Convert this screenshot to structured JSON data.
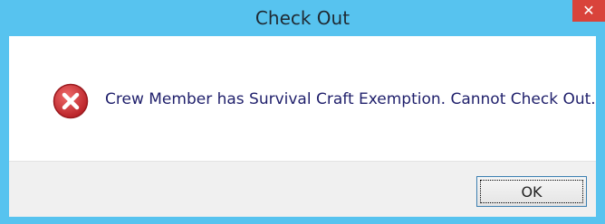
{
  "window": {
    "title": "Check Out",
    "close_glyph": "✕"
  },
  "message": {
    "icon": "error-x-circle-icon",
    "text": "Crew Member has Survival Craft Exemption. Cannot Check Out."
  },
  "buttons": {
    "ok_label": "OK"
  },
  "colors": {
    "titlebar": "#57c3ef",
    "close_button": "#d9433b",
    "error_icon": "#c8252a",
    "message_text": "#1f1f6b",
    "footer": "#f0f0f0"
  }
}
